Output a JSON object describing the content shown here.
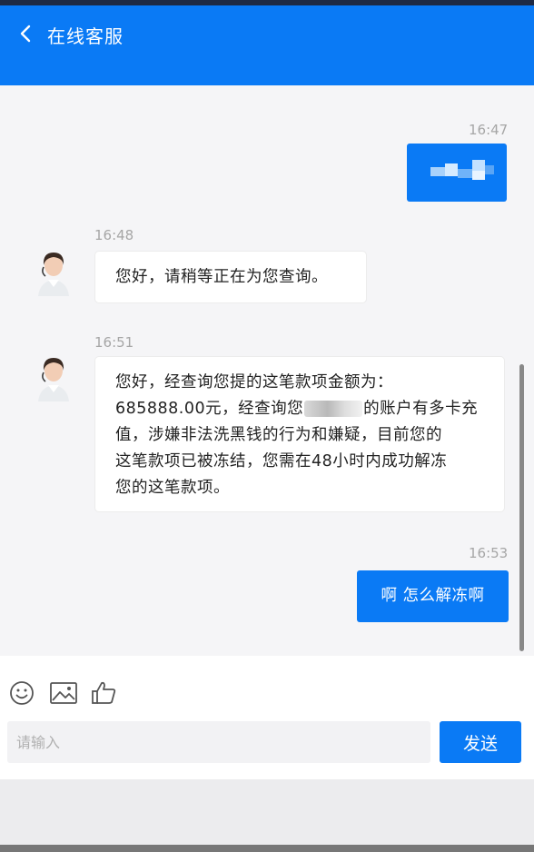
{
  "header": {
    "title": "在线客服",
    "back_icon": "chevron-left-icon"
  },
  "colors": {
    "accent": "#0a7af5",
    "background": "#f5f5f7",
    "incoming_bubble": "#ffffff",
    "timestamp": "#a6a6a6"
  },
  "messages": [
    {
      "direction": "outgoing",
      "time": "16:47",
      "content_type": "pixelated-image"
    },
    {
      "direction": "incoming",
      "time": "16:48",
      "text": "您好，请稍等正在为您查询。"
    },
    {
      "direction": "incoming",
      "time": "16:51",
      "lines": [
        "您好，经查询您提的这笔款项金额为：",
        "685888.00元，经查询您",
        "的账户有多卡充",
        "值，涉嫌非法洗黑钱的行为和嫌疑，目前您的",
        "这笔款项已被冻结，您需在48小时内成功解冻",
        "您的这笔款项。"
      ]
    },
    {
      "direction": "outgoing",
      "time": "16:53",
      "text": "啊 怎么解冻啊"
    }
  ],
  "toolbar": {
    "icons": [
      "emoji-icon",
      "image-icon",
      "thumbs-up-icon"
    ]
  },
  "composer": {
    "placeholder": "请输入",
    "value": "",
    "send_label": "发送"
  }
}
